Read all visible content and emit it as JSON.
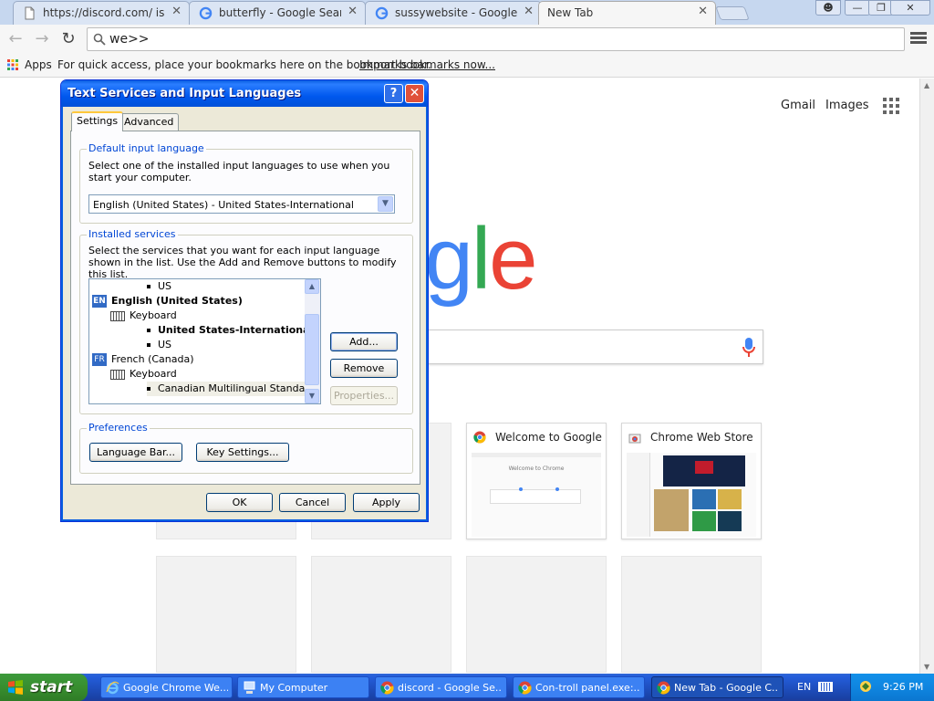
{
  "browser": {
    "tabs": [
      {
        "label": "https://discord.com/ is not a",
        "icon": "page-icon",
        "active": false
      },
      {
        "label": "butterfly - Google Search",
        "icon": "google-icon",
        "active": false
      },
      {
        "label": "sussywebsite - Google Search",
        "icon": "google-icon",
        "active": false
      },
      {
        "label": "New Tab",
        "icon": "none",
        "active": true
      }
    ],
    "omnibox": {
      "value": "we>>"
    },
    "bookmarks": {
      "apps_label": "Apps",
      "hint": "For quick access, place your bookmarks here on the bookmarks bar.",
      "import_link": "Import bookmarks now..."
    }
  },
  "newtab": {
    "header_links": [
      "Gmail",
      "Images"
    ],
    "logo_text": "Google",
    "tiles": [
      {
        "title": "Welcome to Google Chrome",
        "icon": "chrome-icon",
        "thumb_caption": "Welcome to Chrome"
      },
      {
        "title": "Chrome Web Store",
        "icon": "chrome-web-store-icon"
      }
    ]
  },
  "dialog": {
    "title": "Text Services and Input Languages",
    "help_label": "?",
    "close_label": "✕",
    "tabs": [
      "Settings",
      "Advanced"
    ],
    "default_group": {
      "title": "Default input language",
      "description": "Select one of the installed input languages to use when you start your computer.",
      "selected": "English (United States) - United States-International"
    },
    "services_group": {
      "title": "Installed services",
      "description": "Select the services that you want for each input language shown in the list. Use the Add and Remove buttons to modify this list.",
      "tree": [
        {
          "type": "layout",
          "text": "US",
          "bold": false
        },
        {
          "type": "language",
          "badge": "EN",
          "text": "English (United States)",
          "bold": true
        },
        {
          "type": "category",
          "text": "Keyboard",
          "bold": false
        },
        {
          "type": "layout",
          "text": "United States-International",
          "bold": true
        },
        {
          "type": "layout",
          "text": "US",
          "bold": false
        },
        {
          "type": "language",
          "badge": "FR",
          "text": "French (Canada)",
          "bold": false
        },
        {
          "type": "category",
          "text": "Keyboard",
          "bold": false
        },
        {
          "type": "layout",
          "text": "Canadian Multilingual Standard",
          "bold": false
        }
      ],
      "buttons": {
        "add": "Add...",
        "remove": "Remove",
        "properties": "Properties..."
      }
    },
    "preferences_group": {
      "title": "Preferences",
      "buttons": {
        "language_bar": "Language Bar...",
        "key_settings": "Key Settings..."
      }
    },
    "footer": {
      "ok": "OK",
      "cancel": "Cancel",
      "apply": "Apply"
    }
  },
  "taskbar": {
    "start_label": "start",
    "tasks": [
      {
        "label": "Google Chrome We...",
        "icon": "ie-icon",
        "active": false
      },
      {
        "label": "My Computer",
        "icon": "my-computer-icon",
        "active": false
      },
      {
        "label": "discord - Google Se...",
        "icon": "chrome-icon",
        "active": false
      },
      {
        "label": "Con-troll panel.exe:...",
        "icon": "chrome-icon",
        "active": false
      },
      {
        "label": "New Tab - Google C...",
        "icon": "chrome-icon",
        "active": true
      }
    ],
    "language": "EN",
    "clock": "9:26 PM"
  }
}
